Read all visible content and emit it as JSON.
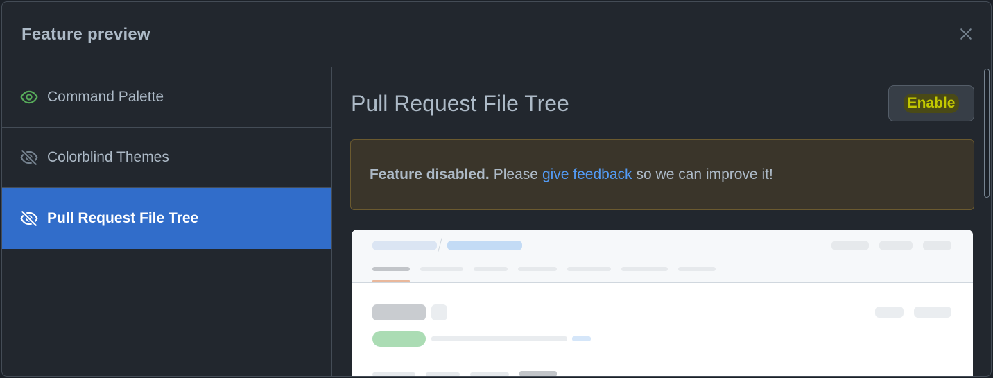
{
  "dialog": {
    "title": "Feature preview",
    "close_icon": "x-icon"
  },
  "sidebar": {
    "items": [
      {
        "label": "Command Palette",
        "icon": "eye-icon",
        "icon_color": "#57ab5a",
        "active": false
      },
      {
        "label": "Colorblind Themes",
        "icon": "eye-closed-icon",
        "icon_color": "#768390",
        "active": false
      },
      {
        "label": "Pull Request File Tree",
        "icon": "eye-closed-icon",
        "icon_color": "#ffffff",
        "active": true
      }
    ]
  },
  "main": {
    "feature_title": "Pull Request File Tree",
    "enable_label": "Enable",
    "flash": {
      "bold": "Feature disabled.",
      "pre_link": "Please",
      "link": "give feedback",
      "post_link": "so we can improve it!"
    }
  },
  "colors": {
    "accent": "#316dca",
    "link": "#539bf5",
    "background": "#22272e",
    "warning_bg": "#3a352a"
  }
}
